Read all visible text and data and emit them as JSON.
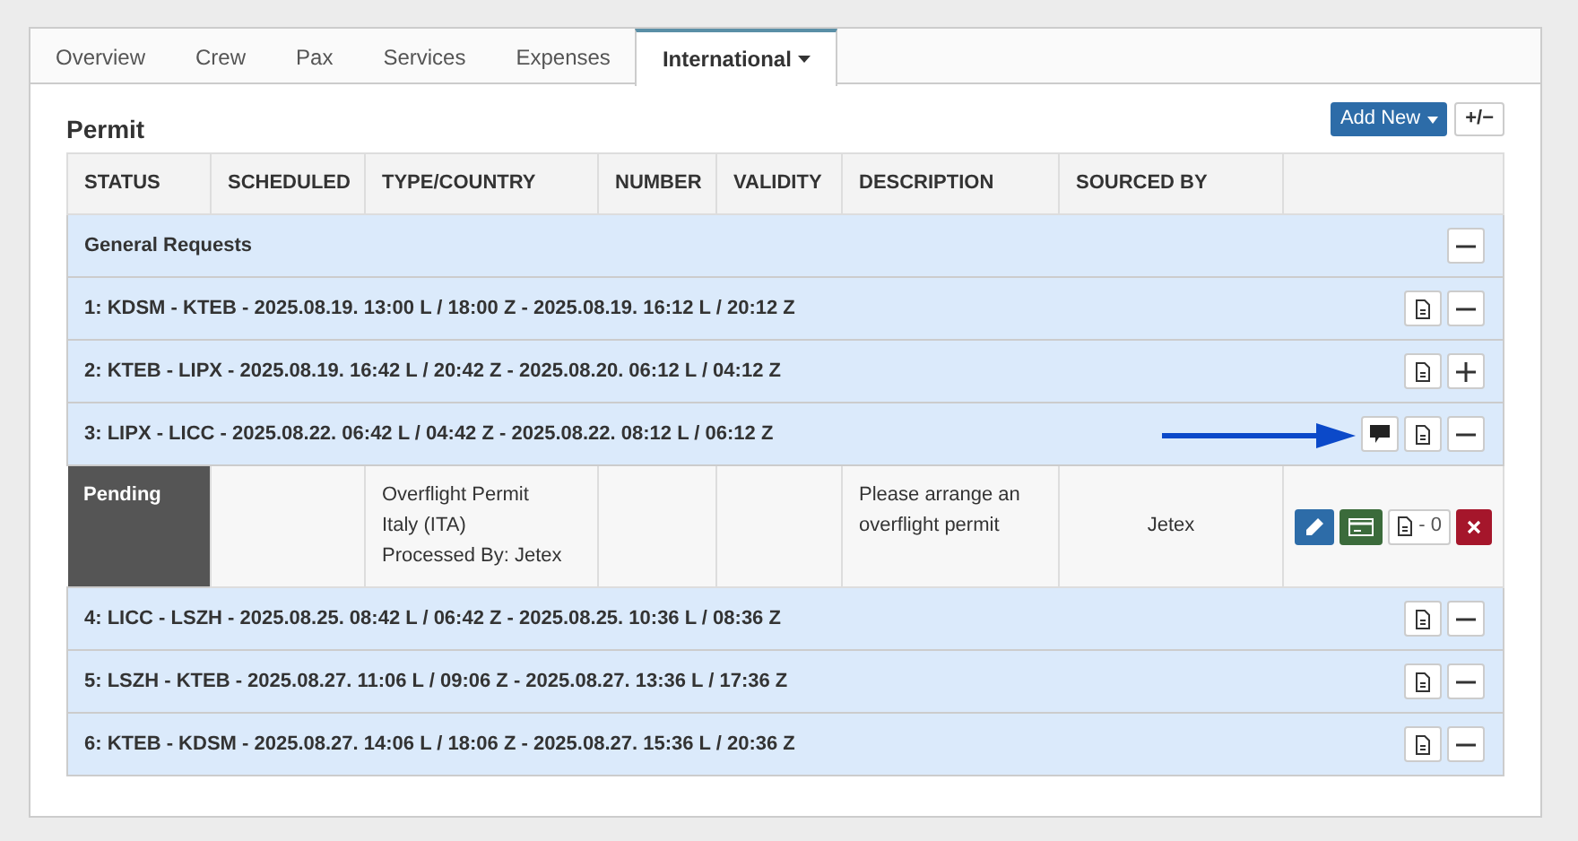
{
  "tabs": [
    {
      "label": "Overview",
      "selected": false
    },
    {
      "label": "Crew",
      "selected": false
    },
    {
      "label": "Pax",
      "selected": false
    },
    {
      "label": "Services",
      "selected": false
    },
    {
      "label": "Expenses",
      "selected": false
    },
    {
      "label": "International",
      "selected": true,
      "dropdown": true
    }
  ],
  "section_title": "Permit",
  "toolbar": {
    "add_button": "Add New",
    "toggle_button": "+/−"
  },
  "table": {
    "columns": [
      "STATUS",
      "SCHEDULED",
      "TYPE/COUNTRY",
      "NUMBER",
      "VALIDITY",
      "DESCRIPTION",
      "SOURCED BY"
    ],
    "groups": [
      {
        "title": "General Requests",
        "expanded": true
      },
      {
        "title": "1: KDSM - KTEB - 2025.08.19. 13:00 L / 18:00 Z - 2025.08.19. 16:12 L / 20:12 Z",
        "expanded": true,
        "has_document": true
      },
      {
        "title": "2: KTEB - LIPX - 2025.08.19. 16:42 L / 20:42 Z - 2025.08.20. 06:12 L / 04:12 Z",
        "expanded": false,
        "has_document": true
      },
      {
        "title": "3: LIPX - LICC - 2025.08.22. 06:42 L / 04:42 Z - 2025.08.22. 08:12 L / 06:12 Z",
        "expanded": true,
        "has_document": true,
        "has_comment": true,
        "pointer_arrow": true,
        "permits": [
          {
            "status": "Pending",
            "type_lines": [
              "Overflight Permit",
              "Italy (ITA)",
              "Processed By: Jetex"
            ],
            "description": "Please arrange an overflight permit",
            "sourced_by": "Jetex",
            "document_count": "- 0"
          }
        ]
      },
      {
        "title": "4: LICC - LSZH - 2025.08.25. 08:42 L / 06:42 Z - 2025.08.25. 10:36 L / 08:36 Z",
        "expanded": true,
        "has_document": true
      },
      {
        "title": "5: LSZH - KTEB - 2025.08.27. 11:06 L / 09:06 Z - 2025.08.27. 13:36 L / 17:36 Z",
        "expanded": true,
        "has_document": true
      },
      {
        "title": "6: KTEB - KDSM - 2025.08.27. 14:06 L / 18:06 Z - 2025.08.27. 15:36 L / 20:36 Z",
        "expanded": true,
        "has_document": true
      }
    ]
  }
}
